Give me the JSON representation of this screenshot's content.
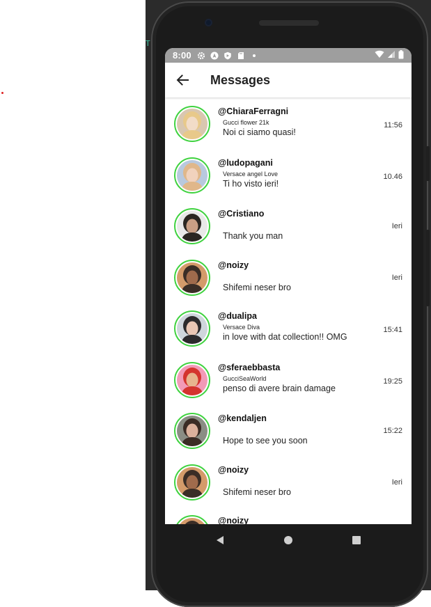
{
  "status_bar": {
    "time": "8:00",
    "left_icons": [
      "settings-icon",
      "nav-icon",
      "shield-icon",
      "sd-card-icon",
      "dot-icon"
    ],
    "right_icons": [
      "wifi-icon",
      "signal-icon",
      "battery-icon"
    ]
  },
  "app_bar": {
    "back_icon": "arrow-left-icon",
    "title": "Messages"
  },
  "colors": {
    "avatar_ring": "#3fd23f",
    "status_bar": "#9e9e9e",
    "phone_body": "#1b1b1b"
  },
  "conversations": [
    {
      "handle": "@ChiaraFerragni",
      "subtitle": "Gucci flower 21k",
      "message": "Noi ci siamo quasi!",
      "time": "11:56",
      "avatar_palette": [
        "#d9c7b0",
        "#e8c98a",
        "#f2dcc8"
      ]
    },
    {
      "handle": "@ludopagani",
      "subtitle": "Versace angel Love",
      "message": "Ti ho visto ieri!",
      "time": "10.46",
      "avatar_palette": [
        "#b8c9de",
        "#e0b78a",
        "#f1d2bd"
      ]
    },
    {
      "handle": "@Cristiano",
      "subtitle": "",
      "message": "Thank you man",
      "time": "Ieri",
      "avatar_palette": [
        "#e9e9e9",
        "#2b2622",
        "#c99e84"
      ]
    },
    {
      "handle": "@noizy",
      "subtitle": "",
      "message": "Shifemi neser bro",
      "time": "Ieri",
      "avatar_palette": [
        "#d49b6a",
        "#3a2d26",
        "#a06b4c"
      ]
    },
    {
      "handle": "@dualipa",
      "subtitle": "Versace Diva",
      "message": "in love with dat collection!! OMG",
      "time": "15:41",
      "avatar_palette": [
        "#cfd6dc",
        "#2c2a2c",
        "#e9c6b4"
      ]
    },
    {
      "handle": "@sferaebbasta",
      "subtitle": "GucciSeaWorld",
      "message": "penso di avere brain damage",
      "time": "19:25",
      "avatar_palette": [
        "#f29ab7",
        "#d4342e",
        "#e7b48e"
      ]
    },
    {
      "handle": "@kendaljen",
      "subtitle": "",
      "message": "Hope to see you soon",
      "time": "15:22",
      "avatar_palette": [
        "#8a8d84",
        "#3b2c25",
        "#dcb19c"
      ]
    },
    {
      "handle": "@noizy",
      "subtitle": "",
      "message": "Shifemi neser bro",
      "time": "Ieri",
      "avatar_palette": [
        "#d49b6a",
        "#3a2d26",
        "#a06b4c"
      ]
    },
    {
      "handle": "@noizy",
      "subtitle": "",
      "message": "",
      "time": "",
      "avatar_palette": [
        "#d49b6a",
        "#3a2d26",
        "#a06b4c"
      ]
    }
  ],
  "nav_bar": {
    "buttons": [
      "back-triangle-icon",
      "home-circle-icon",
      "recents-square-icon"
    ]
  }
}
